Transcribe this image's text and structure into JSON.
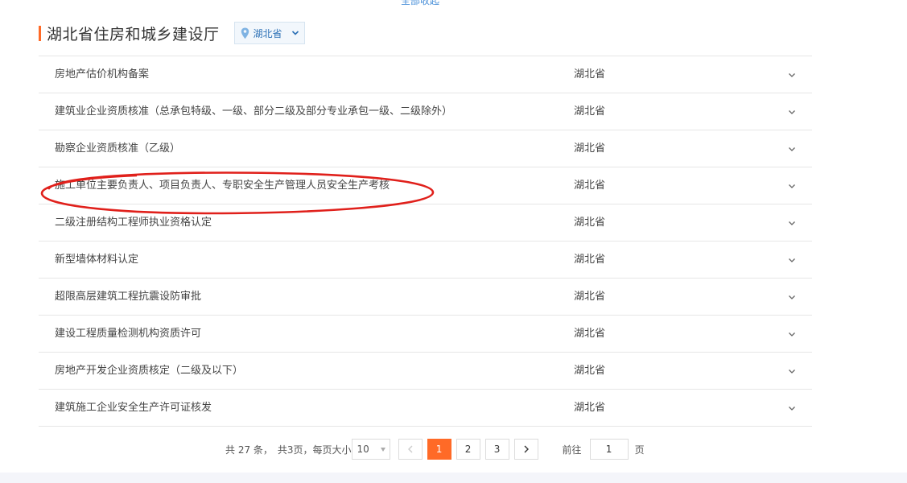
{
  "top_link": "全部收起",
  "header": {
    "title": "湖北省住房和城乡建设厅",
    "region_select": "湖北省"
  },
  "items": [
    {
      "name": "房地产估价机构备案",
      "region": "湖北省"
    },
    {
      "name": "建筑业企业资质核准（总承包特级、一级、部分二级及部分专业承包一级、二级除外）",
      "region": "湖北省"
    },
    {
      "name": "勘察企业资质核准（乙级）",
      "region": "湖北省"
    },
    {
      "name": "施工单位主要负责人、项目负责人、专职安全生产管理人员安全生产考核",
      "region": "湖北省"
    },
    {
      "name": "二级注册结构工程师执业资格认定",
      "region": "湖北省"
    },
    {
      "name": "新型墙体材料认定",
      "region": "湖北省"
    },
    {
      "name": "超限高层建筑工程抗震设防审批",
      "region": "湖北省"
    },
    {
      "name": "建设工程质量检测机构资质许可",
      "region": "湖北省"
    },
    {
      "name": "房地产开发企业资质核定（二级及以下）",
      "region": "湖北省"
    },
    {
      "name": "建筑施工企业安全生产许可证核发",
      "region": "湖北省"
    }
  ],
  "pagination": {
    "total_text": "共 27 条，",
    "summary_text": "共3页，每页大小",
    "page_size": "10",
    "pages": [
      "1",
      "2",
      "3"
    ],
    "current_page": "1",
    "goto_label": "前往",
    "goto_value": "1",
    "goto_unit": "页"
  },
  "colors": {
    "accent": "#ff6a27",
    "annotation": "#e0201b",
    "link": "#2a6fb5"
  }
}
